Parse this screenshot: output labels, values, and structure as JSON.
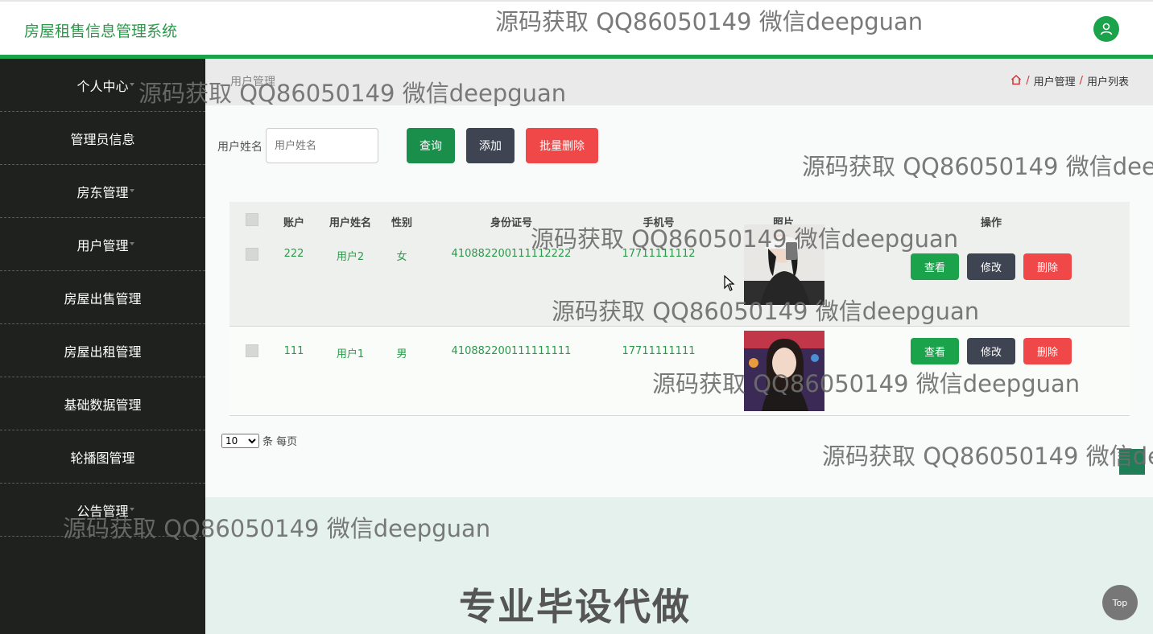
{
  "header": {
    "app_title": "房屋租售信息管理系统",
    "user_icon": "user-icon"
  },
  "sidebar": {
    "items": [
      {
        "label": "个人中心"
      },
      {
        "label": "管理员信息"
      },
      {
        "label": "房东管理"
      },
      {
        "label": "用户管理"
      },
      {
        "label": "房屋出售管理"
      },
      {
        "label": "房屋出租管理"
      },
      {
        "label": "基础数据管理"
      },
      {
        "label": "轮播图管理"
      },
      {
        "label": "公告管理"
      }
    ]
  },
  "page": {
    "title": "用户管理",
    "breadcrumb": {
      "home_icon": "home-icon",
      "separator": "/",
      "items": [
        "用户管理",
        "用户列表"
      ]
    }
  },
  "search": {
    "label": "用户姓名",
    "placeholder": "用户姓名",
    "query_label": "查询",
    "add_label": "添加",
    "batch_delete_label": "批量删除"
  },
  "table": {
    "columns": [
      "账户",
      "用户姓名",
      "性别",
      "身份证号",
      "手机号",
      "照片",
      "操作"
    ],
    "rows": [
      {
        "account": "222",
        "name": "用户2",
        "gender": "女",
        "id_number": "410882200111112222",
        "phone": "17711111112"
      },
      {
        "account": "111",
        "name": "用户1",
        "gender": "男",
        "id_number": "410882200111111111",
        "phone": "17711111111"
      }
    ],
    "actions": {
      "view": "查看",
      "edit": "修改",
      "delete": "删除"
    }
  },
  "pagination": {
    "page_size": "10",
    "suffix": "条 每页"
  },
  "footer": {
    "slogan": "专业毕设代做"
  },
  "back_to_top": "Top",
  "watermark": "源码获取 QQ86050149 微信deepguan",
  "colors": {
    "brand_green": "#1aa34a",
    "sidebar_bg": "#1f211f",
    "danger": "#f04848",
    "dark_button": "#3e4452"
  }
}
